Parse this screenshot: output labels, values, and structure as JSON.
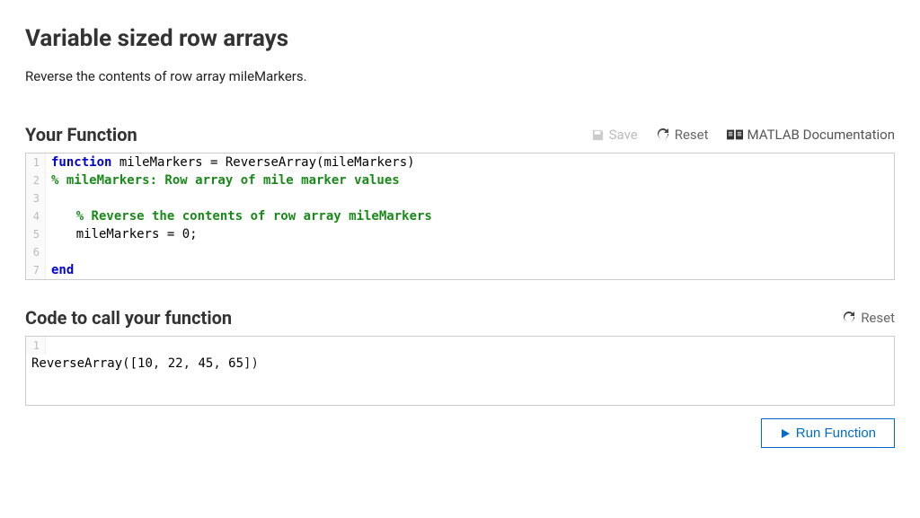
{
  "title": "Variable sized row arrays",
  "description": "Reverse the contents of row array mileMarkers.",
  "section1": {
    "heading": "Your Function",
    "save": "Save",
    "reset": "Reset",
    "doc": "MATLAB Documentation"
  },
  "editor1": {
    "l1a": "function",
    "l1b": " mileMarkers = ReverseArray(mileMarkers)",
    "l2": "% mileMarkers: Row array of mile marker values",
    "l3": "",
    "l4": "% Reverse the contents of row array mileMarkers",
    "l5": "mileMarkers = 0;",
    "l6": "",
    "l7": "end"
  },
  "section2": {
    "heading": "Code to call your function",
    "reset": "Reset"
  },
  "editor2": {
    "l1a": "ReverseArray([",
    "l1b": "10",
    "l1c": ", ",
    "l1d": "22",
    "l1e": ", ",
    "l1f": "45",
    "l1g": ", ",
    "l1h": "65",
    "l1i": "])"
  },
  "run": "Run Function",
  "gutter": {
    "n1": "1",
    "n2": "2",
    "n3": "3",
    "n4": "4",
    "n5": "5",
    "n6": "6",
    "n7": "7"
  }
}
